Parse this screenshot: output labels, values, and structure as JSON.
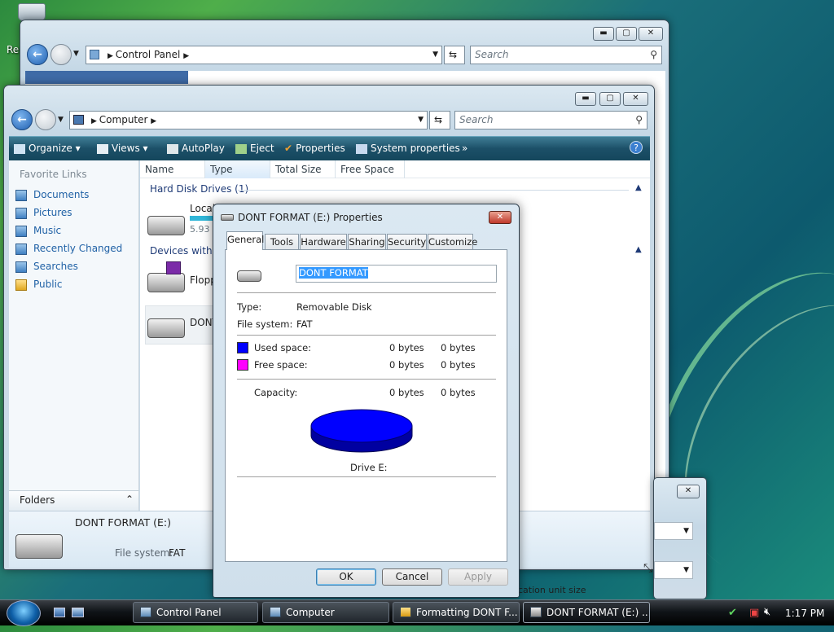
{
  "desktop": {
    "label_fragment": "Re"
  },
  "control_panel_window": {
    "breadcrumb": "Control Panel",
    "search_placeholder": "Search"
  },
  "computer_window": {
    "breadcrumb": "Computer",
    "search_placeholder": "Search",
    "toolbar": [
      "Organize",
      "Views",
      "AutoPlay",
      "Eject",
      "Properties",
      "System properties",
      "»"
    ],
    "favorite_links_title": "Favorite Links",
    "favorite_links": [
      "Documents",
      "Pictures",
      "Music",
      "Recently Changed",
      "Searches",
      "Public"
    ],
    "folders_label": "Folders",
    "columns": [
      "Name",
      "Type",
      "Total Size",
      "Free Space"
    ],
    "groups": {
      "hard_disk": "Hard Disk Drives (1)",
      "removable": "Devices with R"
    },
    "items": {
      "local_disk": "Local Disk (C:)",
      "local_disk_size": "5.93 G",
      "floppy": "Flopp",
      "dont": "DONT"
    },
    "details": {
      "name": "DONT FORMAT (E:)",
      "fs_label": "File system:",
      "fs_value": "FAT"
    }
  },
  "format_window": {
    "bottom_text": "cation unit size"
  },
  "dialog": {
    "title": "DONT FORMAT (E:) Properties",
    "tabs": [
      "General",
      "Tools",
      "Hardware",
      "Sharing",
      "Security",
      "Customize"
    ],
    "label_value": "DONT FORMAT",
    "type_label": "Type:",
    "type_value": "Removable Disk",
    "fs_label": "File system:",
    "fs_value": "FAT",
    "used_label": "Used space:",
    "used_bytes": "0 bytes",
    "used_bytes2": "0 bytes",
    "free_label": "Free space:",
    "free_bytes": "0 bytes",
    "free_bytes2": "0 bytes",
    "capacity_label": "Capacity:",
    "capacity_bytes": "0 bytes",
    "capacity_bytes2": "0 bytes",
    "drive_label": "Drive E:",
    "used_color": "#0000ff",
    "free_color": "#ff00ff",
    "buttons": {
      "ok": "OK",
      "cancel": "Cancel",
      "apply": "Apply"
    }
  },
  "taskbar": {
    "tasks": [
      "Control Panel",
      "Computer",
      "Formatting DONT F...",
      "DONT FORMAT (E:) ..."
    ],
    "clock": "1:17 PM"
  }
}
